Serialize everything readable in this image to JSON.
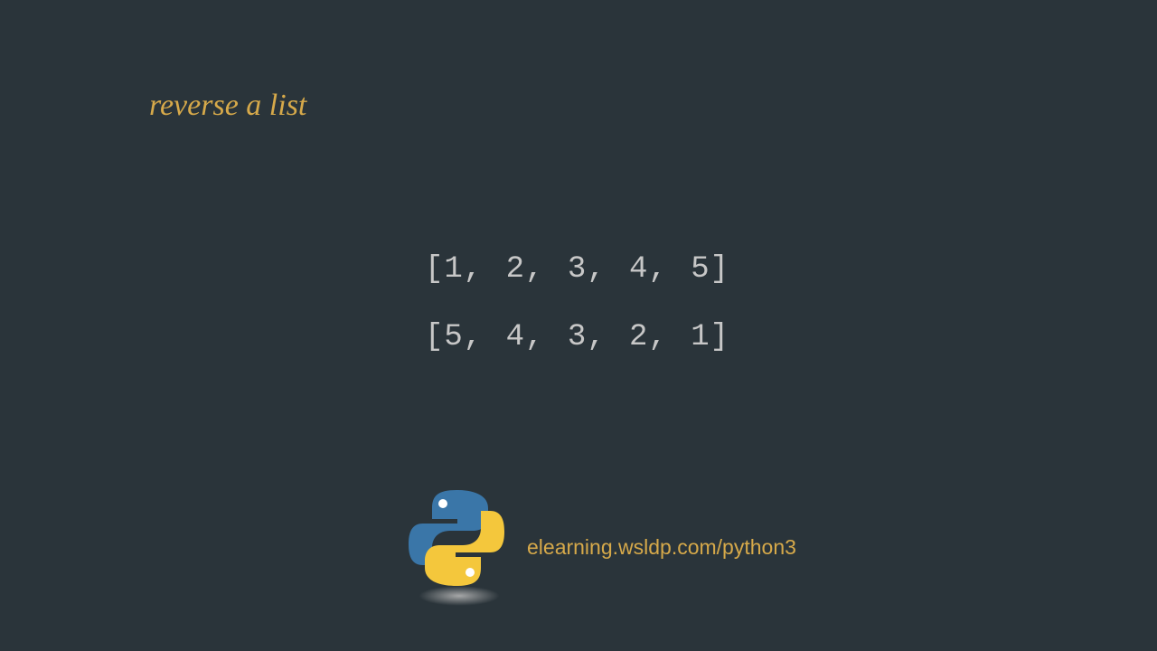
{
  "title": "reverse a list",
  "code": {
    "line1": "[1, 2, 3, 4, 5]",
    "line2": "[5, 4, 3, 2, 1]"
  },
  "footer": {
    "url": "elearning.wsldp.com/python3"
  }
}
